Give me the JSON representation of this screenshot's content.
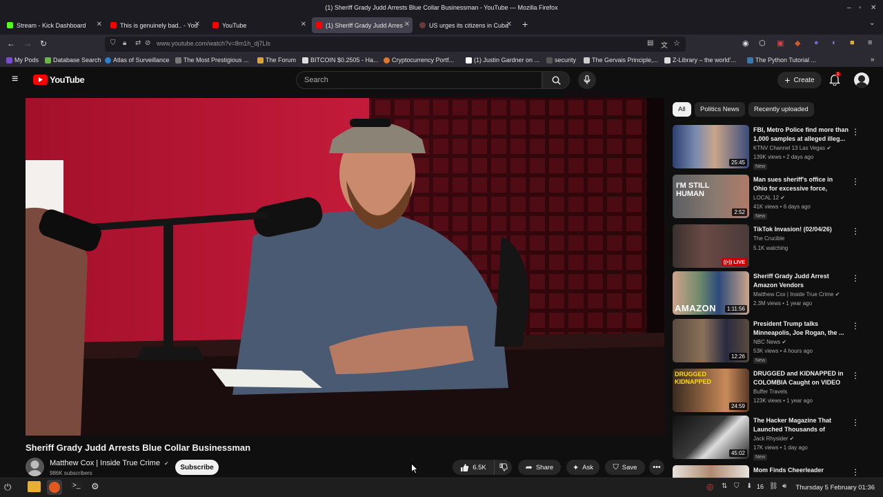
{
  "window": {
    "title": "(1) Sheriff Grady Judd Arrests Blue Collar Businessman - YouTube — Mozilla Firefox"
  },
  "tabs": [
    {
      "label": "Stream - Kick Dashboard",
      "color": "#53fc18"
    },
    {
      "label": "This is genuinely bad.. - You",
      "color": "#ff0000"
    },
    {
      "label": "YouTube",
      "color": "#ff0000"
    },
    {
      "label": "(1) Sheriff Grady Judd Arres",
      "color": "#ff0000"
    },
    {
      "label": "US urges its citizens in Cuba",
      "color": "#6b3b3b"
    }
  ],
  "nav": {
    "url": "www.youtube.com/watch?v=8m1h_dj7Lls"
  },
  "bookmarks": [
    {
      "label": "My Pods",
      "color": "#7b4ad6"
    },
    {
      "label": "Database Search",
      "color": "#6cb34c"
    },
    {
      "label": "Atlas of Surveillance",
      "color": "#2f7fd1"
    },
    {
      "label": "The Most Prestigious ...",
      "color": "#777777"
    },
    {
      "label": "The Forum",
      "color": "#d9a33a"
    },
    {
      "label": "BITCOIN $0.2505 - Ha...",
      "color": "#dddddd"
    },
    {
      "label": "Cryptocurrency Portf...",
      "color": "#e0772e"
    },
    {
      "label": "(1) Justin Gardner on ...",
      "color": "#ffffff"
    },
    {
      "label": "security",
      "color": "#555555"
    },
    {
      "label": "The Gervais Principle,...",
      "color": "#cccccc"
    },
    {
      "label": "Z-Library – the world'...",
      "color": "#dddddd"
    },
    {
      "label": "The Python Tutorial ...",
      "color": "#3b77a8"
    }
  ],
  "youtube": {
    "logo": "YouTube",
    "search_placeholder": "Search",
    "create_label": "Create",
    "notification_count": "1"
  },
  "video": {
    "title": "Sheriff Grady Judd Arrests Blue Collar Businessman",
    "channel": "Matthew Cox | Inside True Crime",
    "subscribers": "986K subscribers",
    "subscribe_label": "Subscribe",
    "likes": "6.5K",
    "share_label": "Share",
    "ask_label": "Ask",
    "save_label": "Save"
  },
  "chips": [
    "All",
    "Politics News",
    "Recently uploaded"
  ],
  "recommendations": [
    {
      "title": "FBI, Metro Police find more than 1,000 samples at alleged illeg...",
      "channel": "KTNV Channel 13 Las Vegas",
      "meta": "139K views • 2 days ago",
      "duration": "25:45",
      "new": "New",
      "thumb": "#3a4a6a"
    },
    {
      "title": "Man sues sheriff's office in Ohio for excessive force, retaliation",
      "channel": "LOCAL 12",
      "meta": "41K views • 6 days ago",
      "duration": "2:52",
      "new": "New",
      "thumb": "#6a5a58",
      "thumb_text": "I'M STILL HUMAN"
    },
    {
      "title": "TikTok Invasion! (02/04/26)",
      "channel": "The Crucible",
      "meta": "5.1K watching",
      "duration": "LIVE",
      "new": "",
      "thumb": "#4a3a3a"
    },
    {
      "title": "Sheriff Grady Judd Arrest Amazon Vendors",
      "channel": "Matthew Cox | Inside True Crime",
      "meta": "2.3M views • 1 year ago",
      "duration": "1:11:56",
      "new": "",
      "thumb": "#5a6a5a",
      "thumb_text": "AMAZON"
    },
    {
      "title": "President Trump talks Minneapolis, Joe Rogan, the ...",
      "channel": "NBC News",
      "meta": "53K views • 4 hours ago",
      "duration": "12:26",
      "new": "New",
      "thumb": "#6a5a4a"
    },
    {
      "title": "DRUGGED and KIDNAPPED in COLOMBIA Caught on VIDEO 🇨🇴",
      "channel": "Buffer Travels",
      "meta": "123K views • 1 year ago",
      "duration": "24:59",
      "new": "",
      "thumb": "#5a4030",
      "thumb_text": "DRUGGED KIDNAPPED"
    },
    {
      "title": "The Hacker Magazine That Launched Thousands of Cyber...",
      "channel": "Jack Rhysider",
      "meta": "17K views • 1 day ago",
      "duration": "45:02",
      "new": "New",
      "thumb": "#2a2a2a"
    },
    {
      "title": "Mom Finds Cheerleader",
      "channel": "",
      "meta": "",
      "duration": "",
      "new": "",
      "thumb": "#d0c8c0"
    }
  ],
  "taskbar": {
    "clock": "Thursday  5 February 01:36",
    "tray_num": "16"
  }
}
